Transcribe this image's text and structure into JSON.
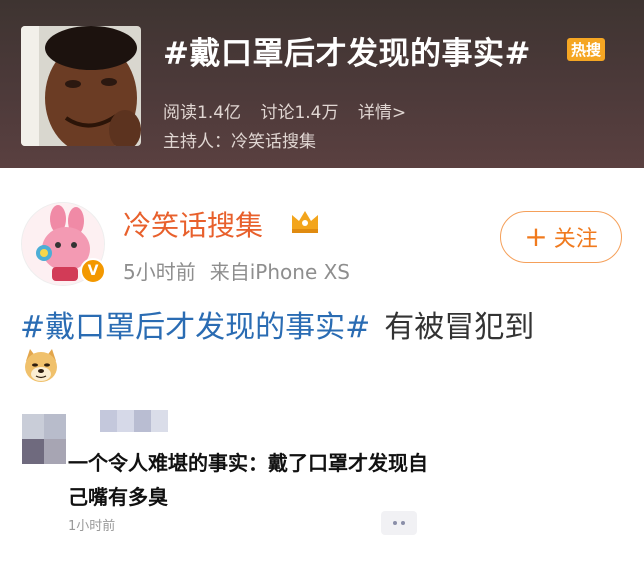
{
  "topic": {
    "title": "#戴口罩后才发现的事实#",
    "hot_badge": "热搜",
    "reads": "阅读1.4亿",
    "discussions": "讨论1.4万",
    "details_link": "详情>",
    "host": "主持人：冷笑话搜集"
  },
  "post": {
    "author": "冷笑话搜集",
    "verified_mark": "V",
    "time": "5小时前",
    "source": "来自iPhone XS",
    "follow_plus": "+",
    "follow_label": "关注",
    "hashtag": "#戴口罩后才发现的事实#",
    "text": "有被冒犯到"
  },
  "comment": {
    "text": "一个令人难堪的事实：戴了口罩才发现自己嘴有多臭",
    "time": "1小时前"
  },
  "icons": {
    "topic_avatar": "smiling-man-avatar",
    "author_avatar": "pink-rabbit-avatar",
    "crown": "crown-icon",
    "emoji": "doge-emoji",
    "more": "more-icon"
  },
  "colors": {
    "header_bg": "#4a3937",
    "hot_badge": "#f5a623",
    "author_name": "#e8602c",
    "hashtag": "#2a6cb3",
    "follow_border": "#f5a05a",
    "verified": "#f39800"
  }
}
